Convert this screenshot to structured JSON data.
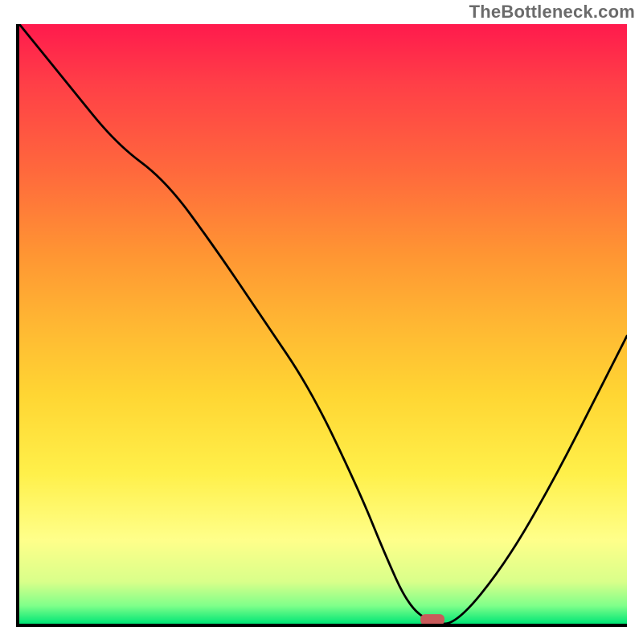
{
  "watermark": "TheBottleneck.com",
  "chart_data": {
    "type": "line",
    "title": "",
    "xlabel": "",
    "ylabel": "",
    "xlim": [
      0,
      100
    ],
    "ylim": [
      0,
      100
    ],
    "grid": false,
    "background": "heatmap-gradient",
    "gradient_stops": [
      {
        "pos": 0,
        "color": "#ff1a4d"
      },
      {
        "pos": 25,
        "color": "#ff6a3c"
      },
      {
        "pos": 50,
        "color": "#ffb733"
      },
      {
        "pos": 75,
        "color": "#fff04a"
      },
      {
        "pos": 93,
        "color": "#d9ff8a"
      },
      {
        "pos": 100,
        "color": "#00e676"
      }
    ],
    "series": [
      {
        "name": "bottleneck-curve",
        "x": [
          0,
          8,
          16,
          24,
          32,
          40,
          48,
          56,
          60,
          64,
          68,
          72,
          80,
          88,
          96,
          100
        ],
        "y": [
          100,
          90,
          80,
          74,
          63,
          51,
          39,
          22,
          12,
          3,
          0,
          0,
          10,
          24,
          40,
          48
        ]
      }
    ],
    "marker": {
      "name": "optimal-point",
      "x": 68,
      "y": 0,
      "shape": "rounded-rect",
      "color": "#c95b5b"
    }
  }
}
